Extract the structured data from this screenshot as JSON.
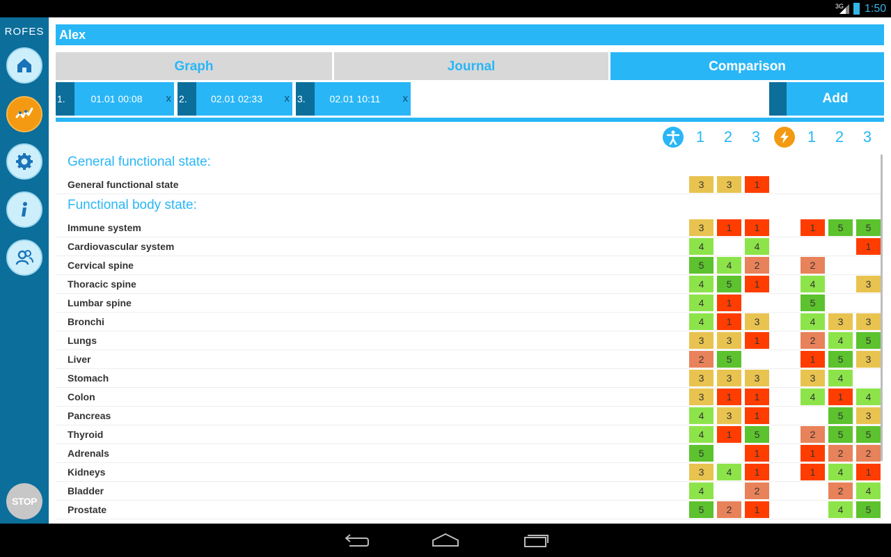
{
  "status": {
    "network": "3G",
    "time": "1:50"
  },
  "app": {
    "logo": "ROFES"
  },
  "sidebar": {
    "items": [
      {
        "name": "home",
        "icon": "home-icon"
      },
      {
        "name": "measure",
        "icon": "wave-icon"
      },
      {
        "name": "settings",
        "icon": "gear-icon"
      },
      {
        "name": "info",
        "icon": "info-icon"
      },
      {
        "name": "users",
        "icon": "users-icon"
      }
    ],
    "stop_label": "STOP"
  },
  "user": {
    "name": "Alex"
  },
  "tabs": [
    {
      "label": "Graph",
      "active": false
    },
    {
      "label": "Journal",
      "active": false
    },
    {
      "label": "Comparison",
      "active": true
    }
  ],
  "sessions": [
    {
      "num": "1.",
      "datetime": "01.01  00:08",
      "close": "x"
    },
    {
      "num": "2.",
      "datetime": "02.01  02:33",
      "close": "x"
    },
    {
      "num": "3.",
      "datetime": "02.01  10:11",
      "close": "x"
    }
  ],
  "add_label": "Add",
  "column_groups": [
    {
      "icon": "body-icon",
      "color": "#29b6f6",
      "cols": [
        "1",
        "2",
        "3"
      ]
    },
    {
      "icon": "lightning-icon",
      "color": "#f39a12",
      "cols": [
        "1",
        "2",
        "3"
      ]
    }
  ],
  "colors": {
    "1": "#ff3d00",
    "2": "#e8825a",
    "3": "#e8c34f",
    "4": "#8de44a",
    "5": "#5cc22e",
    "accent": "#29b6f6",
    "sidebar": "#0c6e9b"
  },
  "sections": [
    {
      "title": "General functional state:",
      "rows": [
        {
          "label": "General functional state",
          "a": [
            "3",
            "3",
            "1"
          ],
          "b": [
            "",
            "",
            ""
          ]
        }
      ]
    },
    {
      "title": "Functional body state:",
      "rows": [
        {
          "label": "Immune system",
          "a": [
            "3",
            "1",
            "1"
          ],
          "b": [
            "1",
            "5",
            "5"
          ]
        },
        {
          "label": "Cardiovascular system",
          "a": [
            "4",
            "",
            "4"
          ],
          "b": [
            "",
            "",
            "1"
          ]
        },
        {
          "label": "Cervical spine",
          "a": [
            "5",
            "4",
            "2"
          ],
          "b": [
            "2",
            "",
            ""
          ]
        },
        {
          "label": "Thoracic spine",
          "a": [
            "4",
            "5",
            "1"
          ],
          "b": [
            "4",
            "",
            "3"
          ]
        },
        {
          "label": "Lumbar spine",
          "a": [
            "4",
            "1",
            ""
          ],
          "b": [
            "5",
            "",
            ""
          ]
        },
        {
          "label": "Bronchi",
          "a": [
            "4",
            "1",
            "3"
          ],
          "b": [
            "4",
            "3",
            "3"
          ]
        },
        {
          "label": "Lungs",
          "a": [
            "3",
            "3",
            "1"
          ],
          "b": [
            "2",
            "4",
            "5"
          ]
        },
        {
          "label": "Liver",
          "a": [
            "2",
            "5",
            ""
          ],
          "b": [
            "1",
            "5",
            "3"
          ]
        },
        {
          "label": "Stomach",
          "a": [
            "3",
            "3",
            "3"
          ],
          "b": [
            "3",
            "4",
            ""
          ]
        },
        {
          "label": "Colon",
          "a": [
            "3",
            "1",
            "1"
          ],
          "b": [
            "4",
            "1",
            "4"
          ]
        },
        {
          "label": "Pancreas",
          "a": [
            "4",
            "3",
            "1"
          ],
          "b": [
            "",
            "5",
            "3"
          ]
        },
        {
          "label": "Thyroid",
          "a": [
            "4",
            "1",
            "5"
          ],
          "b": [
            "2",
            "5",
            "5"
          ]
        },
        {
          "label": "Adrenals",
          "a": [
            "5",
            "",
            "1"
          ],
          "b": [
            "1",
            "2",
            "2"
          ]
        },
        {
          "label": "Kidneys",
          "a": [
            "3",
            "4",
            "1"
          ],
          "b": [
            "1",
            "4",
            "1"
          ]
        },
        {
          "label": "Bladder",
          "a": [
            "4",
            "",
            "2"
          ],
          "b": [
            "",
            "2",
            "4"
          ]
        },
        {
          "label": "Prostate",
          "a": [
            "5",
            "2",
            "1"
          ],
          "b": [
            "",
            "4",
            "5"
          ]
        }
      ]
    }
  ]
}
